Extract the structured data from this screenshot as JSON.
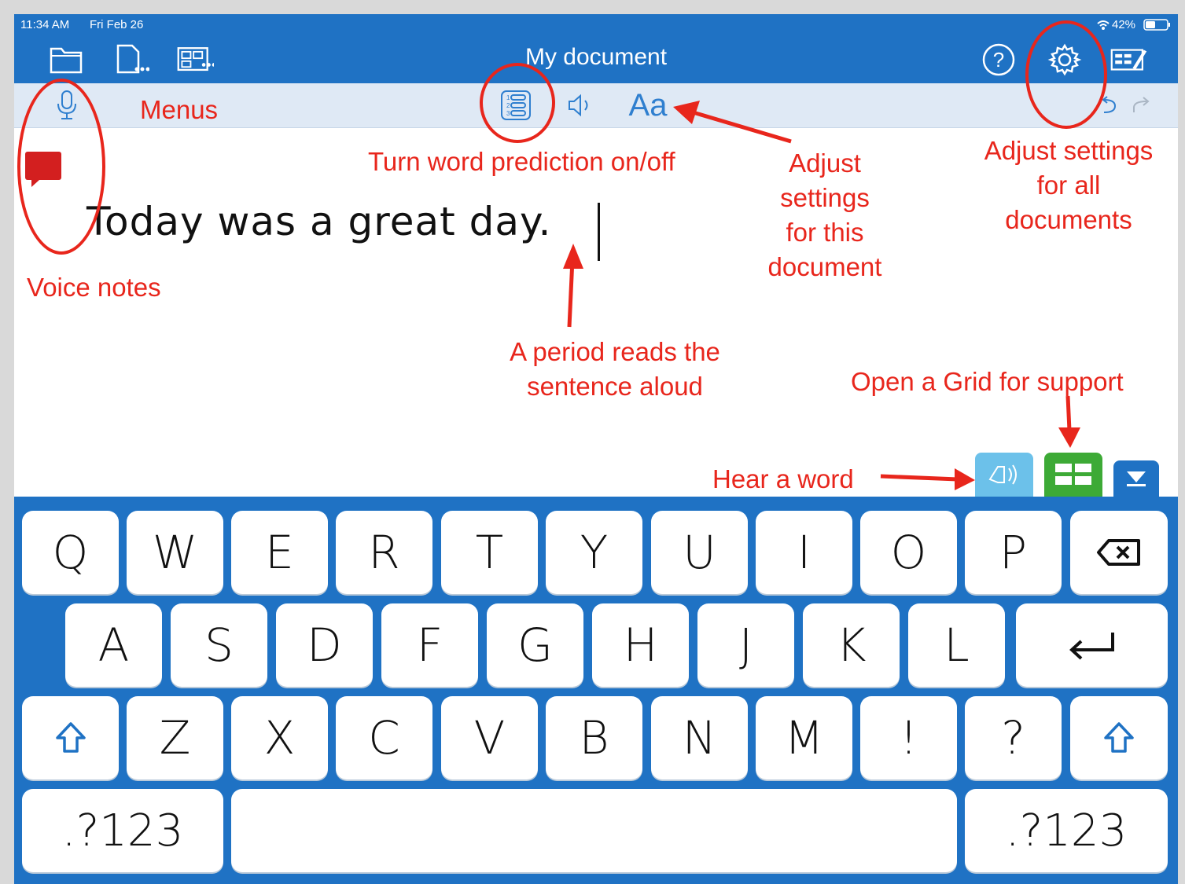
{
  "status": {
    "time": "11:34 AM",
    "date": "Fri Feb 26",
    "battery": "42%"
  },
  "nav": {
    "title": "My document"
  },
  "document": {
    "text": "Today was a great day."
  },
  "icons": {
    "folder": "folder-icon",
    "new_doc": "new-document-icon",
    "layouts": "layouts-icon",
    "help": "help-icon",
    "settings": "gear-icon",
    "edit_keyboard": "edit-keyboard-icon",
    "mic": "microphone-icon",
    "prediction": "word-prediction-icon",
    "speaker": "speaker-icon",
    "text_style": "text-style-icon",
    "undo": "undo-icon",
    "redo": "redo-icon"
  },
  "toolbar": {
    "text_style_label": "Aa"
  },
  "annotations": {
    "menus": "Menus",
    "voice_notes": "Voice notes",
    "prediction": "Turn word prediction on/off",
    "doc_settings": [
      "Adjust",
      "settings",
      "for this",
      "document"
    ],
    "all_settings": [
      "Adjust settings",
      "for all",
      "documents"
    ],
    "period": [
      "A period reads the",
      "sentence aloud"
    ],
    "grid": "Open a Grid for support",
    "hear_word": "Hear a word"
  },
  "keyboard": {
    "row1": [
      "Q",
      "W",
      "E",
      "R",
      "T",
      "Y",
      "U",
      "I",
      "O",
      "P"
    ],
    "row2": [
      "A",
      "S",
      "D",
      "F",
      "G",
      "H",
      "J",
      "K",
      "L"
    ],
    "row3": [
      "Z",
      "X",
      "C",
      "V",
      "B",
      "N",
      "M",
      "!",
      "?"
    ],
    "numbers_label": ".?123"
  },
  "colors": {
    "primary": "#1f72c4",
    "annotation": "#e8261c",
    "hear": "#6cc1ea",
    "grid": "#3daa36"
  }
}
